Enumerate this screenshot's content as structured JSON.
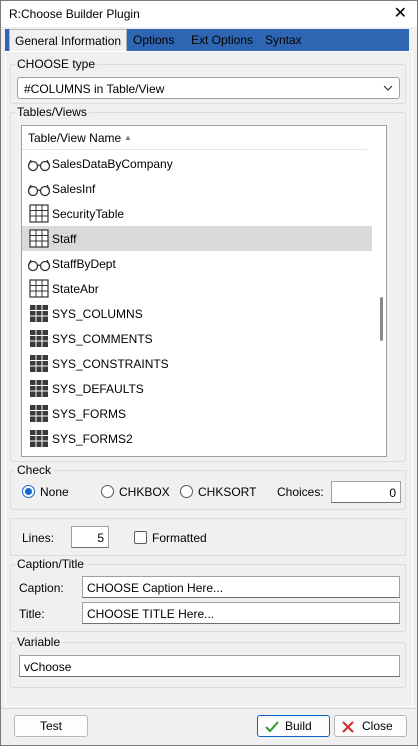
{
  "window": {
    "title": "R:Choose Builder Plugin",
    "close_glyph": "✕"
  },
  "tabs": [
    {
      "label": "General Information",
      "active": true
    },
    {
      "label": "Options"
    },
    {
      "label": "Ext Options"
    },
    {
      "label": "Syntax"
    }
  ],
  "choose_type": {
    "legend": "CHOOSE type",
    "value": "#COLUMNS in Table/View",
    "icon": "chevron-down-icon"
  },
  "tables_views": {
    "legend": "Tables/Views",
    "column_header": "Table/View Name",
    "sort_glyph": "▲",
    "rows": [
      {
        "name": "SalesDataByCompany",
        "icon": "view-icon"
      },
      {
        "name": "SalesInf",
        "icon": "view-icon"
      },
      {
        "name": "SecurityTable",
        "icon": "table-icon"
      },
      {
        "name": "Staff",
        "icon": "table-icon",
        "selected": true
      },
      {
        "name": "StaffByDept",
        "icon": "view-icon"
      },
      {
        "name": "StateAbr",
        "icon": "table-icon"
      },
      {
        "name": "SYS_COLUMNS",
        "icon": "system-table-icon"
      },
      {
        "name": "SYS_COMMENTS",
        "icon": "system-table-icon"
      },
      {
        "name": "SYS_CONSTRAINTS",
        "icon": "system-table-icon"
      },
      {
        "name": "SYS_DEFAULTS",
        "icon": "system-table-icon"
      },
      {
        "name": "SYS_FORMS",
        "icon": "system-table-icon"
      },
      {
        "name": "SYS_FORMS2",
        "icon": "system-table-icon"
      }
    ]
  },
  "check": {
    "legend": "Check",
    "options": [
      {
        "label": "None",
        "selected": true
      },
      {
        "label": "CHKBOX"
      },
      {
        "label": "CHKSORT"
      }
    ],
    "choices_label": "Choices:",
    "choices_value": "0"
  },
  "lines": {
    "label": "Lines:",
    "value": "5",
    "formatted_label": "Formatted",
    "formatted_checked": false
  },
  "caption_title": {
    "legend": "Caption/Title",
    "caption_label": "Caption:",
    "caption_value": "CHOOSE Caption Here...",
    "title_label": "Title:",
    "title_value": "CHOOSE TITLE Here..."
  },
  "variable": {
    "legend": "Variable",
    "value": "vChoose"
  },
  "buttons": {
    "test": "Test",
    "build": "Build",
    "close": "Close"
  },
  "colors": {
    "tab_strip": "#2f66b3",
    "radio_accent": "#1a66c8",
    "build_check": "#2e9a2e",
    "close_x": "#d12b2b"
  }
}
